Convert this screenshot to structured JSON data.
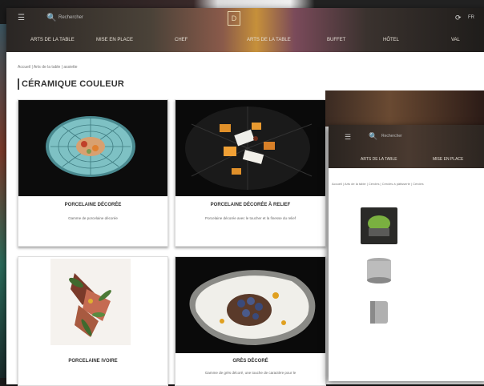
{
  "main_window": {
    "search_label": "Rechercher",
    "right_label": "FR",
    "logo_char": "D",
    "nav": [
      "ARTS DE LA TABLE",
      "MISE EN PLACE",
      "CHEF",
      "ARTS DE LA TABLE",
      "BUFFET",
      "HÔTEL",
      "VAL"
    ],
    "breadcrumb": "Accueil | Arts de la table | assiette",
    "title": "CÉRAMIQUE COULEUR",
    "cards": [
      {
        "name": "PORCELAINE DÉCORÉE",
        "desc": "Gamme de porcelaine décorée"
      },
      {
        "name": "PORCELAINE DÉCORÉE À RELIEF",
        "desc": "Porcelaine décorée avec le toucher et la finesse du relief"
      },
      {
        "name": "PORCELAINE IVOIRE",
        "desc": ""
      },
      {
        "name": "GRÈS DÉCORÉ",
        "desc": "Gamme de grès décoré, une touche de caractère pour le"
      }
    ]
  },
  "secondary_window": {
    "search_label": "Rechercher",
    "nav": [
      "ARTS DE LA TABLE",
      "MISE EN PLACE"
    ],
    "breadcrumb": "Accueil | Arts de la table | Cercles | Cercles à pâtisserie | Cercles"
  },
  "colors": {
    "accent": "#c6903a",
    "dark": "#2a2624"
  }
}
